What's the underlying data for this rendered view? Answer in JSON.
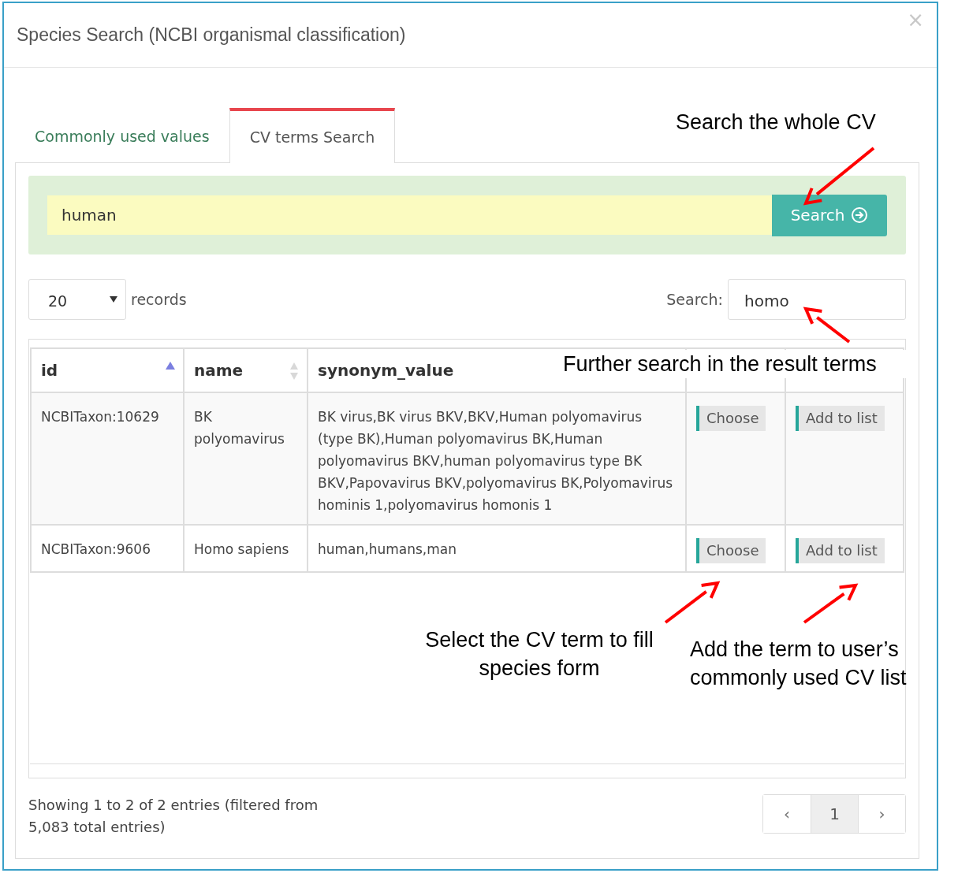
{
  "dialog": {
    "title": "Species Search (NCBI organismal classification)",
    "close": "×"
  },
  "tabs": [
    {
      "label": "Commonly used values",
      "selected": false
    },
    {
      "label": "CV terms Search",
      "selected": true
    }
  ],
  "cv_search": {
    "value": "human",
    "button": "Search"
  },
  "length_menu": {
    "value": "20",
    "label": "records"
  },
  "filter": {
    "label": "Search:",
    "value": "homo"
  },
  "table": {
    "columns": [
      {
        "label": "id",
        "sorted": true
      },
      {
        "label": "name",
        "sorted": false
      },
      {
        "label": "synonym_value"
      },
      {},
      {}
    ],
    "rows": [
      {
        "id": "NCBITaxon:10629",
        "name": "BK polyomavirus",
        "synonym_value": "BK virus,BK virus BKV,BKV,Human polyomavirus (type BK),Human polyomavirus BK,Human polyomavirus BKV,human polyomavirus type BK BKV,Papovavirus BKV,polyomavirus BK,Polyomavirus hominis 1,polyomavirus homonis 1",
        "choose": "Choose",
        "add": "Add to list"
      },
      {
        "id": "NCBITaxon:9606",
        "name": "Homo sapiens",
        "synonym_value": "human,humans,man",
        "choose": "Choose",
        "add": "Add to list"
      }
    ]
  },
  "info": "Showing 1 to 2 of 2 entries (filtered from 5,083 total entries)",
  "pagination": [
    {
      "label": "‹",
      "selected": false
    },
    {
      "label": "1",
      "selected": true
    },
    {
      "label": "›",
      "selected": false
    }
  ],
  "annotations": [
    {
      "text": "Search the whole CV"
    },
    {
      "text": "Further search in the result terms"
    },
    {
      "text": "Select the CV term to fill species form"
    },
    {
      "text": "Add the term to user’s commonly used CV list"
    }
  ]
}
